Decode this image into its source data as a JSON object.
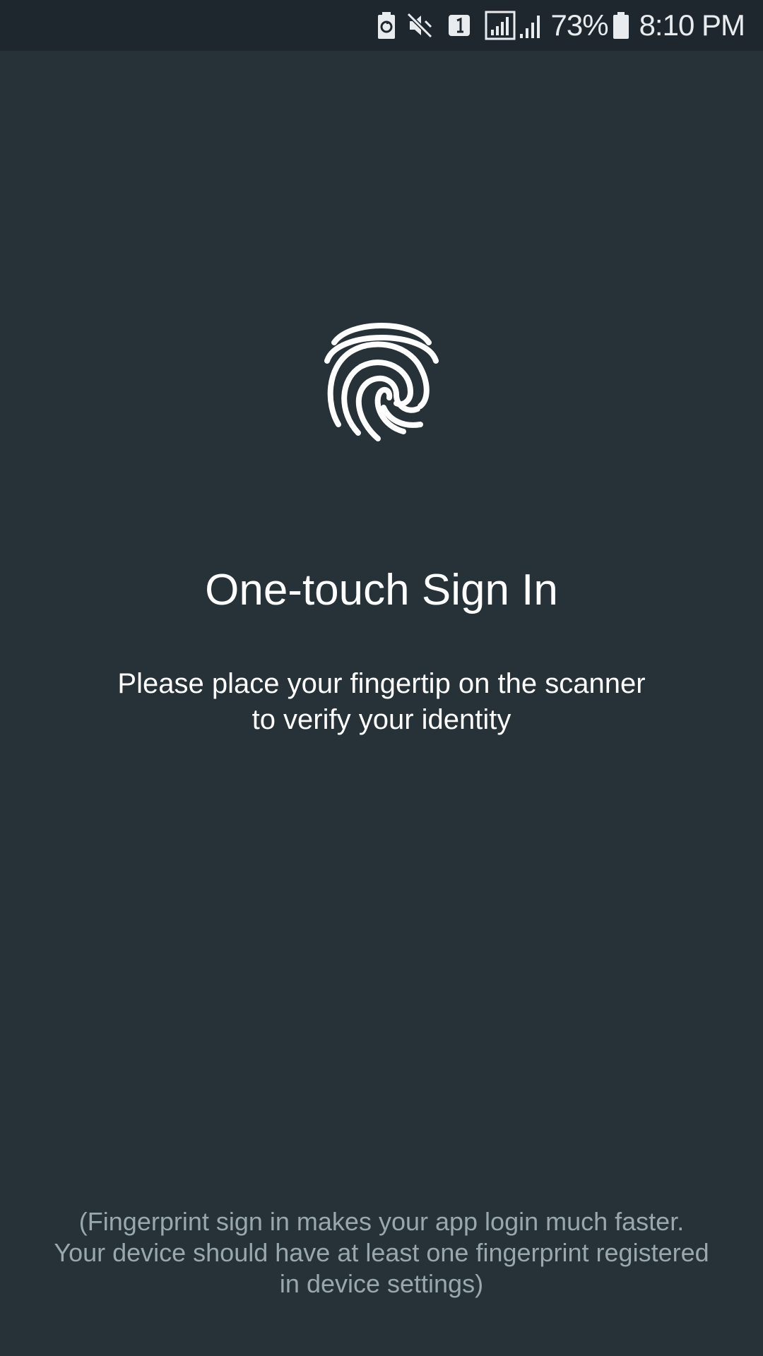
{
  "status_bar": {
    "icons": [
      "battery-saver-icon",
      "mute-icon",
      "sim-1-icon",
      "signal-boxed-icon",
      "signal-icon",
      "battery-icon"
    ],
    "battery_percent": "73%",
    "time": "8:10 PM"
  },
  "colors": {
    "background": "#263138",
    "status_bar": "#1e272d",
    "text_primary": "#ffffff",
    "text_secondary": "#9aa7ae"
  },
  "fingerprint_icon": "fingerprint-icon",
  "title": "One-touch Sign In",
  "subtitle": {
    "line1": "Please place your fingertip on the scanner",
    "line2": "to verify your identity"
  },
  "footer_note": {
    "line1": "(Fingerprint sign in makes your app login much faster.",
    "line2": "Your device should have at least one fingerprint registered",
    "line3": "in device settings)"
  }
}
